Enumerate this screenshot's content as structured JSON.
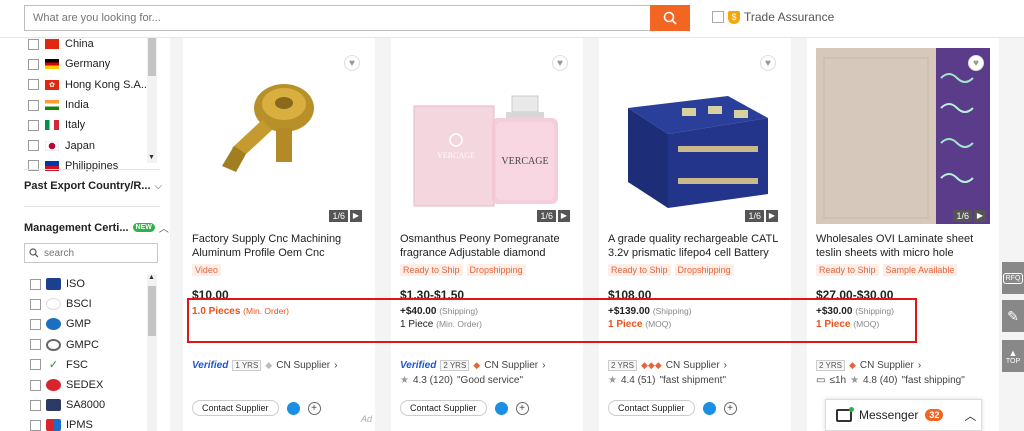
{
  "search": {
    "placeholder": "What are you looking for...",
    "trade_assurance_label": "Trade Assurance"
  },
  "sidebar": {
    "countries": [
      {
        "name": "China",
        "flag": "flag-china"
      },
      {
        "name": "Germany",
        "flag": "flag-germany"
      },
      {
        "name": "Hong Kong S.A...",
        "flag": "flag-hongkong"
      },
      {
        "name": "India",
        "flag": "flag-india"
      },
      {
        "name": "Italy",
        "flag": "flag-italy"
      },
      {
        "name": "Japan",
        "flag": "flag-japan"
      },
      {
        "name": "Philippines",
        "flag": "flag-philippines"
      }
    ],
    "past_export_title": "Past Export Country/R...",
    "management_title": "Management Certi...",
    "new_badge": "NEW",
    "cert_search_placeholder": "search",
    "certifications": [
      {
        "name": "ISO",
        "logo": "iso-logo"
      },
      {
        "name": "BSCI",
        "logo": "bsci-logo"
      },
      {
        "name": "GMP",
        "logo": "gmp-logo"
      },
      {
        "name": "GMPC",
        "logo": "gmpc-logo"
      },
      {
        "name": "FSC",
        "logo": "fsc-logo"
      },
      {
        "name": "SEDEX",
        "logo": "sedex-logo"
      },
      {
        "name": "SA8000",
        "logo": "sa8000-logo"
      },
      {
        "name": "IPMS",
        "logo": "ipms-logo"
      }
    ]
  },
  "products": [
    {
      "image_counter": "1/6",
      "title": "Factory Supply Cnc Machining Aluminum Profile Oem Cnc",
      "tags": [
        "Video"
      ],
      "price": "$10.00",
      "line1_main": "1.0 Pieces",
      "line1_sub": "(Min. Order)",
      "line2_main": "",
      "line2_sub": "",
      "verified": "Verified",
      "years": "1 YRS",
      "supplier": "CN Supplier",
      "rating": "",
      "review": "",
      "response": "",
      "contact_label": "Contact Supplier",
      "ad": "Ad"
    },
    {
      "image_counter": "1/6",
      "title": "Osmanthus Peony Pomegranate fragrance Adjustable diamond",
      "tags": [
        "Ready to Ship",
        "Dropshipping"
      ],
      "price": "$1.30-$1.50",
      "line1_main": "+$40.00",
      "line1_sub": "(Shipping)",
      "line2_main": "1 Piece",
      "line2_sub": "(Min. Order)",
      "verified": "Verified",
      "years": "2 YRS",
      "supplier": "CN Supplier",
      "rating": "4.3 (120)",
      "review": "\"Good service\"",
      "response": "",
      "contact_label": "Contact Supplier",
      "ad": ""
    },
    {
      "image_counter": "1/6",
      "title": "A grade quality rechargeable CATL 3.2v prismatic lifepo4 cell Battery",
      "tags": [
        "Ready to Ship",
        "Dropshipping"
      ],
      "price": "$108.00",
      "line1_main": "+$139.00",
      "line1_sub": "(Shipping)",
      "line2_main": "1 Piece",
      "line2_sub": "(MOQ)",
      "verified": "",
      "years": "2 YRS",
      "supplier": "CN Supplier",
      "rating": "4.4 (51)",
      "review": "\"fast shipment\"",
      "response": "",
      "contact_label": "Contact Supplier",
      "ad": ""
    },
    {
      "image_counter": "1/6",
      "title": "Wholesales OVI Laminate sheet teslin sheets with micro hole",
      "tags": [
        "Ready to Ship",
        "Sample Available"
      ],
      "price": "$27.00-$30.00",
      "line1_main": "+$30.00",
      "line1_sub": "(Shipping)",
      "line2_main": "1 Piece",
      "line2_sub": "(MOQ)",
      "verified": "",
      "years": "2 YRS",
      "supplier": "CN Supplier",
      "rating": "4.8 (40)",
      "review": "\"fast shipping\"",
      "response": "≤1h",
      "contact_label": "",
      "ad": ""
    }
  ],
  "right_tools": {
    "rfq": "RFQ",
    "top": "TOP"
  },
  "messenger": {
    "label": "Messenger",
    "count": "32"
  },
  "colors": {
    "accent": "#f26522",
    "highlight": "#e01515",
    "tag_text": "#e8633a"
  }
}
